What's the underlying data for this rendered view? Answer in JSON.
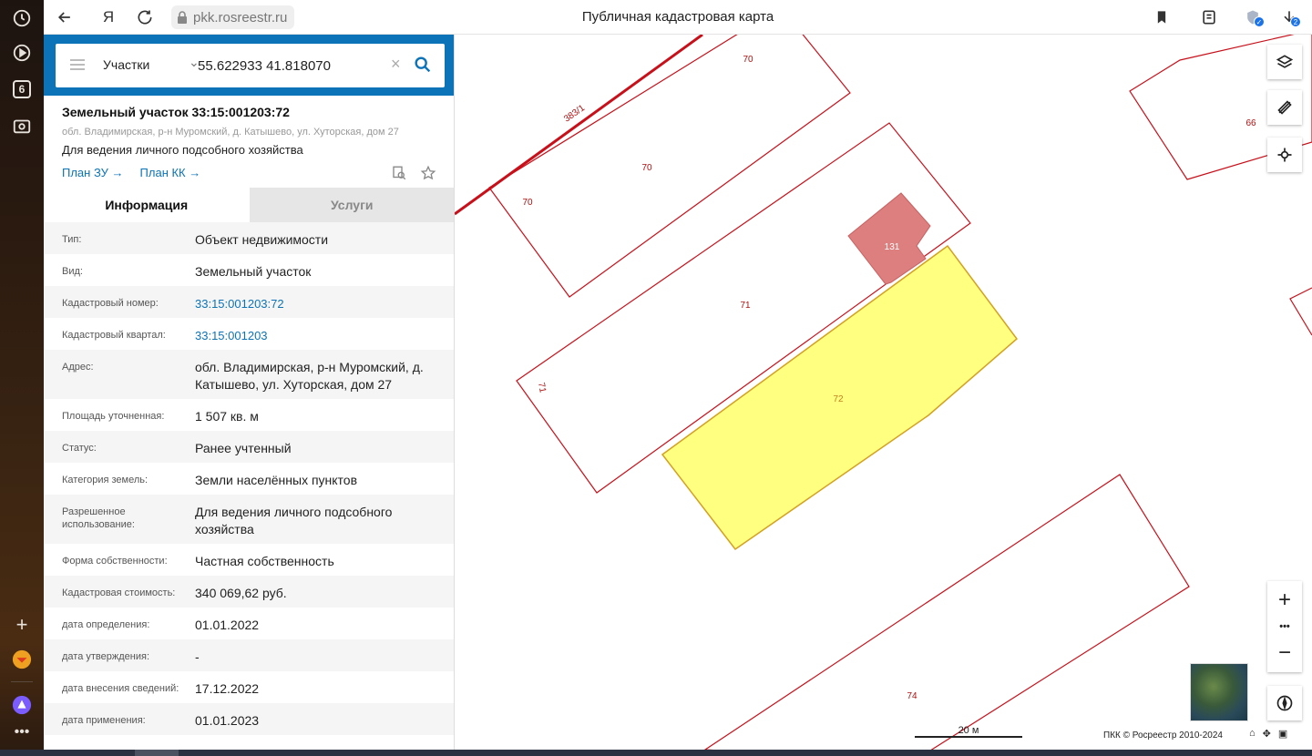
{
  "browser": {
    "url": "pkk.rosreestr.ru",
    "page_title": "Публичная кадастровая карта",
    "rail_tab_count": "6",
    "downloads_badge": "2"
  },
  "search": {
    "type_label": "Участки",
    "query": "55.622933 41.818070"
  },
  "object": {
    "title": "Земельный участок 33:15:001203:72",
    "address_short": "обл. Владимирская, р-н Муромский, д. Катышево, ул. Хуторская, дом 27",
    "use": "Для ведения личного подсобного хозяйства",
    "link_plan_zu": "План ЗУ →",
    "link_plan_kk": "План КК →"
  },
  "tabs": {
    "info": "Информация",
    "services": "Услуги"
  },
  "info_rows": [
    {
      "key": "Тип:",
      "value": "Объект недвижимости"
    },
    {
      "key": "Вид:",
      "value": "Земельный участок"
    },
    {
      "key": "Кадастровый номер:",
      "value": "33:15:001203:72",
      "link": true
    },
    {
      "key": "Кадастровый квартал:",
      "value": "33:15:001203",
      "link": true
    },
    {
      "key": "Адрес:",
      "value": "обл. Владимирская, р-н Муромский, д. Катышево, ул. Хуторская, дом 27"
    },
    {
      "key": "Площадь уточненная:",
      "value": "1 507 кв. м"
    },
    {
      "key": "Статус:",
      "value": "Ранее учтенный"
    },
    {
      "key": "Категория земель:",
      "value": "Земли населённых пунктов"
    },
    {
      "key": "Разрешенное использование:",
      "value": "Для ведения личного подсобного хозяйства"
    },
    {
      "key": "Форма собственности:",
      "value": "Частная собственность"
    },
    {
      "key": "Кадастровая стоимость:",
      "value": "340 069,62 руб."
    },
    {
      "key": "дата определения:",
      "value": "01.01.2022"
    },
    {
      "key": "дата утверждения:",
      "value": "-"
    },
    {
      "key": "дата внесения сведений:",
      "value": "17.12.2022"
    },
    {
      "key": "дата применения:",
      "value": "01.01.2023"
    }
  ],
  "map": {
    "parcel_labels": [
      "70",
      "70",
      "70",
      "383/1",
      "66",
      "131",
      "71",
      "71",
      "72",
      "74"
    ],
    "scale": "20 м",
    "copyright": "ПКК © Росреестр 2010-2024",
    "colors": {
      "boundary": "#c8101a",
      "selected_fill": "#ffff80",
      "selected_stroke": "#d4a020",
      "building_fill": "#de7f7f",
      "panel_accent": "#0c73b8"
    }
  }
}
